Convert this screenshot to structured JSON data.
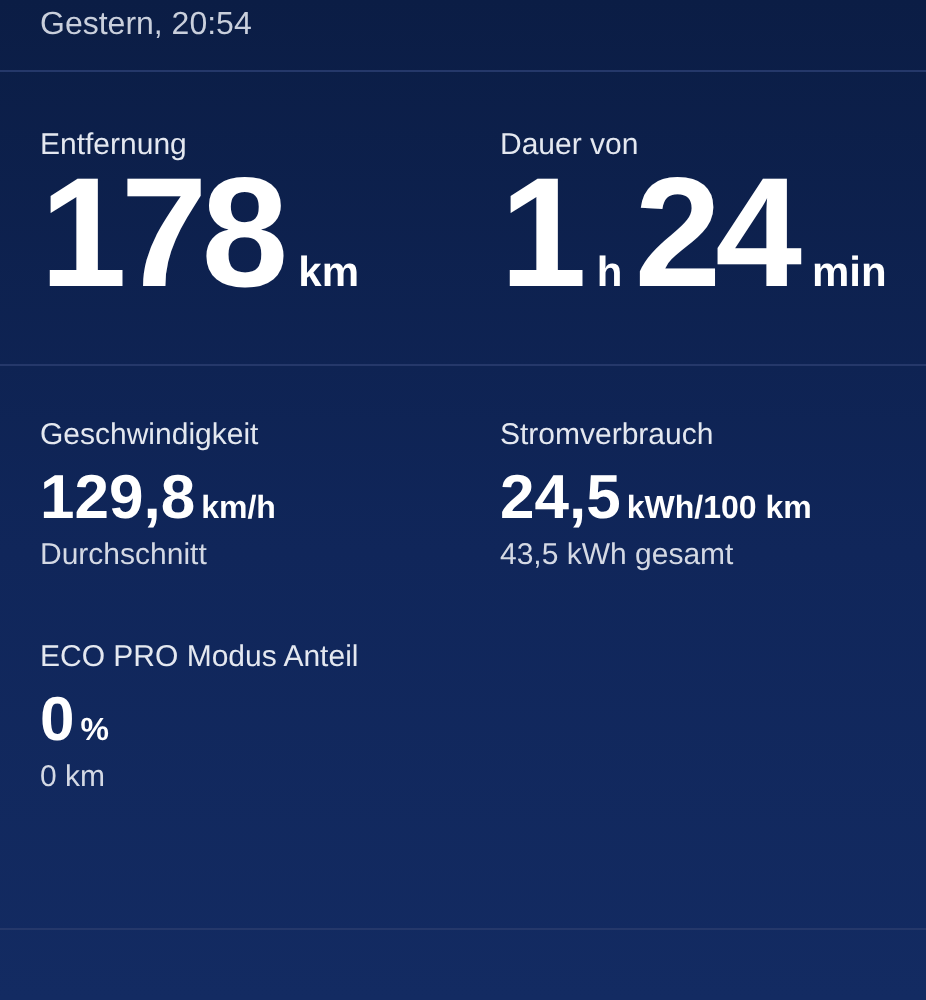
{
  "header": {
    "date": "Gestern, 20:54"
  },
  "summary": [
    {
      "label": "Entfernung",
      "parts": [
        {
          "value": "178",
          "unit": "km"
        }
      ]
    },
    {
      "label": "Dauer von",
      "parts": [
        {
          "value": "1",
          "unit": "h"
        },
        {
          "value": "24",
          "unit": "min"
        }
      ]
    }
  ],
  "stats": [
    {
      "label": "Geschwindigkeit",
      "value": "129,8",
      "unit": "km/h",
      "note": "Durchschnitt"
    },
    {
      "label": "Stromverbrauch",
      "value": "24,5",
      "unit": "kWh/100 km",
      "note": "43,5 kWh gesamt"
    }
  ],
  "eco": {
    "label": "ECO PRO Modus Anteil",
    "value": "0",
    "unit": "%",
    "note": "0 km"
  }
}
